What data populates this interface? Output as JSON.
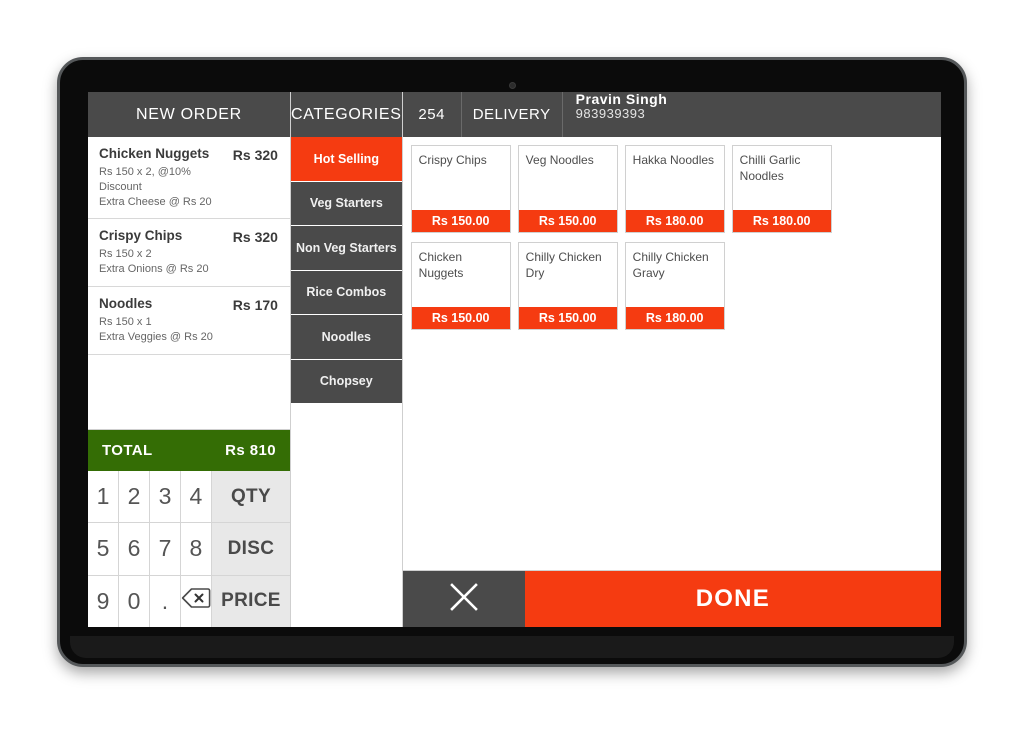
{
  "device": {
    "camera_icon": "camera-dot"
  },
  "order_panel": {
    "title": "NEW ORDER",
    "items": [
      {
        "name": "Chicken Nuggets",
        "detail_1": "Rs 150 x 2, @10% Discount",
        "detail_2": "Extra Cheese @ Rs 20",
        "price": "Rs 320"
      },
      {
        "name": "Crispy Chips",
        "detail_1": "Rs 150 x 2",
        "detail_2": "Extra Onions @ Rs 20",
        "price": "Rs 320"
      },
      {
        "name": "Noodles",
        "detail_1": "Rs 150 x 1",
        "detail_2": "Extra Veggies @ Rs 20",
        "price": "Rs 170"
      }
    ],
    "total_label": "TOTAL",
    "total_value": "Rs 810"
  },
  "keypad": {
    "rows": [
      {
        "keys": [
          "1",
          "2",
          "3",
          "4"
        ],
        "action_label": "QTY",
        "action_name": "qty-button"
      },
      {
        "keys": [
          "5",
          "6",
          "7",
          "8"
        ],
        "action_label": "DISC",
        "action_name": "disc-button"
      },
      {
        "keys": [
          "9",
          "0",
          ".",
          "backspace-icon"
        ],
        "action_label": "PRICE",
        "action_name": "price-button"
      }
    ],
    "backspace_icon": "backspace-icon"
  },
  "categories": {
    "title": "CATEGORIES",
    "active_index": 0,
    "items": [
      "Hot Selling",
      "Veg Starters",
      "Non Veg Starters",
      "Rice Combos",
      "Noodles",
      "Chopsey"
    ]
  },
  "order_header": {
    "order_number": "254",
    "order_type": "DELIVERY",
    "customer_name": "Pravin Singh",
    "customer_phone": "983939393"
  },
  "products": [
    {
      "name": "Crispy Chips",
      "price": "Rs 150.00"
    },
    {
      "name": "Veg Noodles",
      "price": "Rs 150.00"
    },
    {
      "name": "Hakka Noodles",
      "price": "Rs 180.00"
    },
    {
      "name": "Chilli Garlic Noodles",
      "price": "Rs 180.00"
    },
    {
      "name": "Chicken Nuggets",
      "price": "Rs 150.00"
    },
    {
      "name": "Chilly Chicken Dry",
      "price": "Rs 150.00"
    },
    {
      "name": "Chilly Chicken Gravy",
      "price": "Rs 180.00"
    }
  ],
  "actions": {
    "cancel_icon": "close-x-icon",
    "done_label": "DONE"
  },
  "colors": {
    "accent": "#f53b11",
    "header_gray": "#4a4a4a",
    "total_green": "#346d05",
    "key_action_bg": "#e8e8e8"
  }
}
